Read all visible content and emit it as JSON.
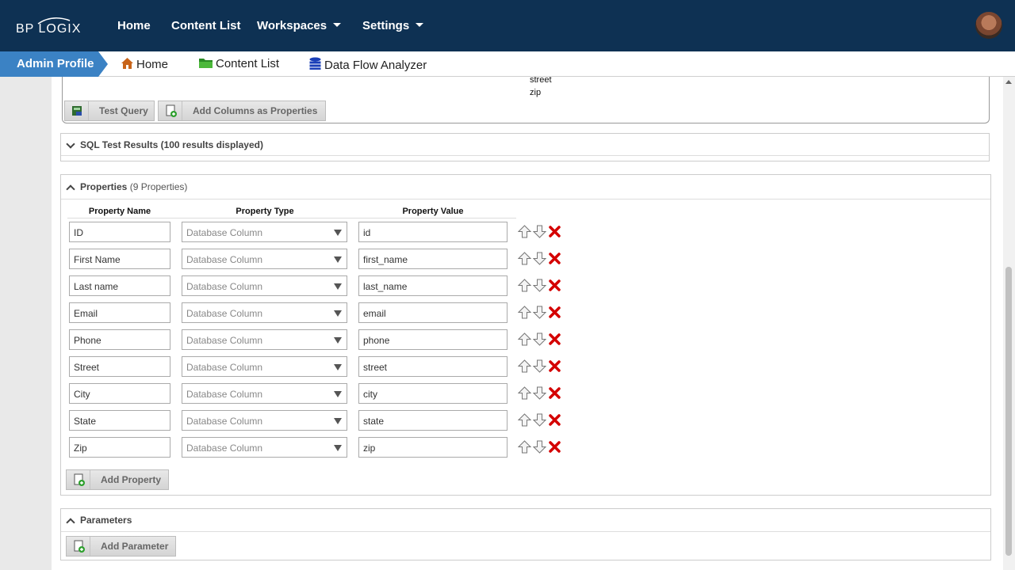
{
  "nav": {
    "logo": "BP LOGIX",
    "items": [
      "Home",
      "Content List",
      "Workspaces",
      "Settings"
    ]
  },
  "breadcrumb": {
    "active": "Admin Profile",
    "links": [
      "Home",
      "Content List",
      "Data Flow Analyzer"
    ]
  },
  "query": {
    "columns": [
      "street",
      "zip"
    ],
    "test_query_label": "Test Query",
    "add_columns_label": "Add Columns as Properties"
  },
  "sql_results": {
    "title": "SQL Test Results (100 results displayed)"
  },
  "properties": {
    "title": "Properties",
    "count": "(9 Properties)",
    "headers": [
      "Property Name",
      "Property Type",
      "Property Value"
    ],
    "rows": [
      {
        "name": "ID",
        "type": "Database Column",
        "value": "id"
      },
      {
        "name": "First Name",
        "type": "Database Column",
        "value": "first_name"
      },
      {
        "name": "Last name",
        "type": "Database Column",
        "value": "last_name"
      },
      {
        "name": "Email",
        "type": "Database Column",
        "value": "email"
      },
      {
        "name": "Phone",
        "type": "Database Column",
        "value": "phone"
      },
      {
        "name": "Street",
        "type": "Database Column",
        "value": "street"
      },
      {
        "name": "City",
        "type": "Database Column",
        "value": "city"
      },
      {
        "name": "State",
        "type": "Database Column",
        "value": "state"
      },
      {
        "name": "Zip",
        "type": "Database Column",
        "value": "zip"
      }
    ],
    "add_label": "Add Property"
  },
  "parameters": {
    "title": "Parameters",
    "add_label": "Add Parameter"
  },
  "colors": {
    "nav_bg": "#0e3153",
    "active_tab": "#3b82c4",
    "delete": "#d40000"
  }
}
